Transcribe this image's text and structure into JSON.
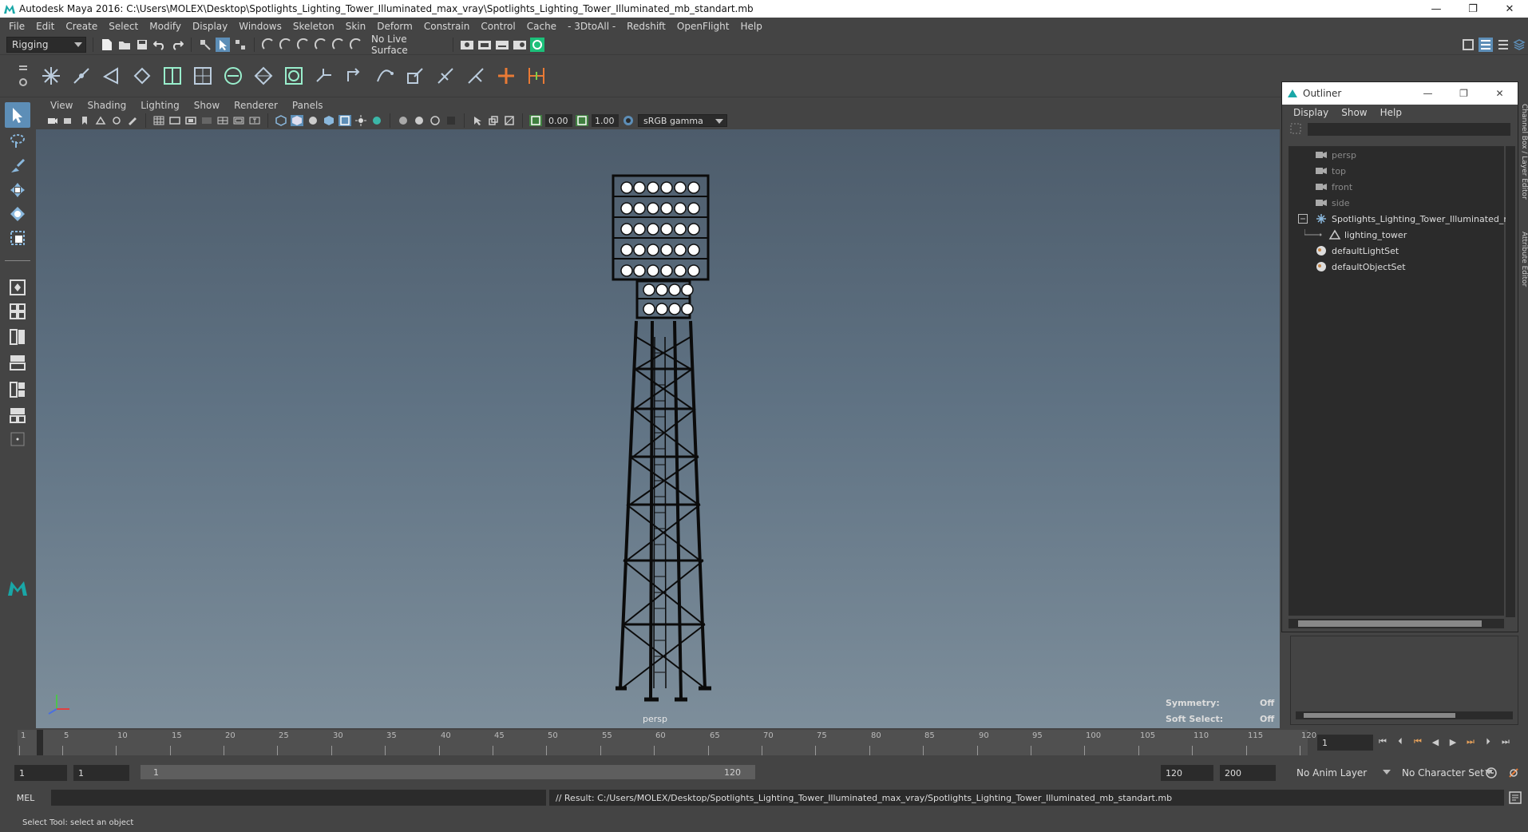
{
  "window": {
    "title": "Autodesk Maya 2016: C:\\Users\\MOLEX\\Desktop\\Spotlights_Lighting_Tower_Illuminated_max_vray\\Spotlights_Lighting_Tower_Illuminated_mb_standart.mb",
    "minimize": "—",
    "restore": "❐",
    "close": "✕"
  },
  "menubar": [
    "File",
    "Edit",
    "Create",
    "Select",
    "Modify",
    "Display",
    "Windows",
    "Skeleton",
    "Skin",
    "Deform",
    "Constrain",
    "Control",
    "Cache",
    "- 3DtoAll -",
    "Redshift",
    "OpenFlight",
    "Help"
  ],
  "statusline": {
    "menuset": "Rigging",
    "live_surface": "No Live Surface"
  },
  "viewport": {
    "menus": [
      "View",
      "Shading",
      "Lighting",
      "Show",
      "Renderer",
      "Panels"
    ],
    "field_a": "0.00",
    "field_b": "1.00",
    "color_space": "sRGB gamma",
    "camera": "persp",
    "symmetry_label": "Symmetry:",
    "symmetry_value": "Off",
    "softselect_label": "Soft Select:",
    "softselect_value": "Off"
  },
  "outliner": {
    "title": "Outliner",
    "menus": [
      "Display",
      "Show",
      "Help"
    ],
    "items": [
      {
        "label": "persp",
        "icon": "camera-icon",
        "dim": true
      },
      {
        "label": "top",
        "icon": "camera-icon",
        "dim": true
      },
      {
        "label": "front",
        "icon": "camera-icon",
        "dim": true
      },
      {
        "label": "side",
        "icon": "camera-icon",
        "dim": true
      },
      {
        "label": "Spotlights_Lighting_Tower_Illuminated_nc",
        "icon": "transform-icon",
        "dim": false
      },
      {
        "label": "lighting_tower",
        "icon": "mesh-icon",
        "dim": false
      },
      {
        "label": "defaultLightSet",
        "icon": "set-icon",
        "dim": false
      },
      {
        "label": "defaultObjectSet",
        "icon": "set-icon",
        "dim": false
      }
    ]
  },
  "side_tabs": [
    "Channel Box / Layer Editor",
    "Attribute Editor"
  ],
  "timeslider": {
    "ticks": [
      "1",
      "5",
      "10",
      "15",
      "20",
      "25",
      "30",
      "35",
      "40",
      "45",
      "50",
      "55",
      "60",
      "65",
      "70",
      "75",
      "80",
      "85",
      "90",
      "95",
      "100",
      "105",
      "110",
      "115",
      "120"
    ],
    "current_frame": "1"
  },
  "rangeslider": {
    "start_time": "1",
    "playback_start": "1",
    "range_start_label": "1",
    "range_end_label": "120",
    "playback_end": "120",
    "end_time": "200",
    "anim_layer": "No Anim Layer",
    "character_set": "No Character Set"
  },
  "commandline": {
    "language": "MEL",
    "result": "// Result: C:/Users/MOLEX/Desktop/Spotlights_Lighting_Tower_Illuminated_max_vray/Spotlights_Lighting_Tower_Illuminated_mb_standart.mb"
  },
  "helpline": "Select Tool: select an object",
  "colors": {
    "accent": "#5d8eb7",
    "panel": "#444444",
    "field": "#2b2b2b",
    "viewport_top": "#4d5c6b",
    "viewport_bottom": "#7d8e9b"
  }
}
